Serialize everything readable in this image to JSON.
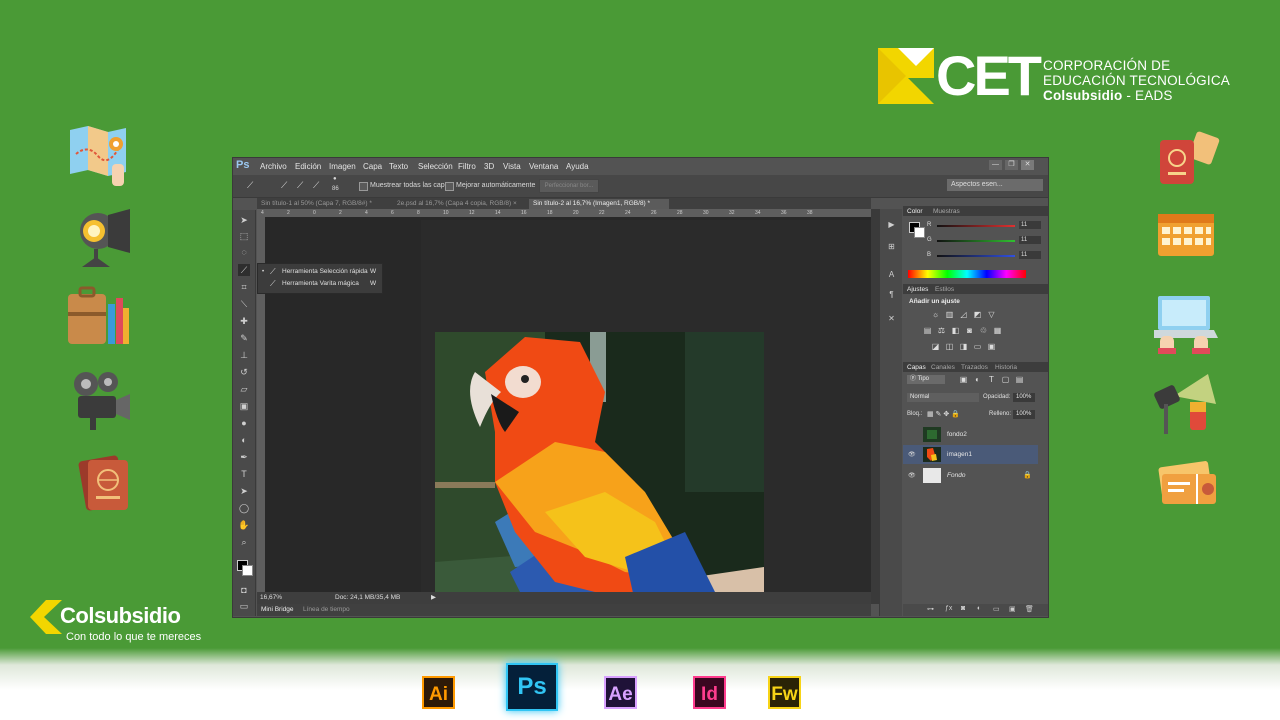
{
  "cet": {
    "word": "CET",
    "line1": "CORPORACIÓN DE",
    "line2": "EDUCACIÓN TECNOLÓGICA",
    "line3_bold": "Colsubsidio",
    "line3_rest": " - EADS"
  },
  "colsubsidio": {
    "name": "Colsubsidio",
    "tagline": "Con todo lo que te mereces"
  },
  "left_icons": [
    "map-pin-icon",
    "spotlight-icon",
    "luggage-books-icon",
    "film-camera-icon",
    "passport-icon"
  ],
  "right_icons": [
    "passport-ticket-icon",
    "calendar-icon",
    "laptop-hands-icon",
    "studio-light-icon",
    "tickets-icon"
  ],
  "photoshop": {
    "logo": "Ps",
    "menu": [
      "Archivo",
      "Edición",
      "Imagen",
      "Capa",
      "Texto",
      "Selección",
      "Filtro",
      "3D",
      "Vista",
      "Ventana",
      "Ayuda"
    ],
    "options": {
      "brush_size": "86",
      "sample_all": "Muestrear todas las capas",
      "auto_enhance": "Mejorar automáticamente",
      "refine_edge": "Perfeccionar bor...",
      "workspace": "Aspectos esen..."
    },
    "doc_tabs": [
      {
        "label": "Sin título-1 al 50% (Capa 7, RGB/8#) *",
        "active": false
      },
      {
        "label": "2e.psd al 16,7% (Capa 4 copia, RGB/8) ×",
        "active": false
      },
      {
        "label": "Sin título-2 al 16,7% (Imagen1, RGB/8) *",
        "active": true
      }
    ],
    "ruler_marks": [
      "4",
      "2",
      "0",
      "2",
      "4",
      "6",
      "8",
      "10",
      "12",
      "14",
      "16",
      "18",
      "20",
      "22",
      "24",
      "26",
      "28",
      "30",
      "32",
      "34",
      "36",
      "38"
    ],
    "flyout": [
      {
        "label": "Herramienta Selección rápida",
        "key": "W"
      },
      {
        "label": "Herramienta Varita mágica",
        "key": "W"
      }
    ],
    "status": {
      "zoom": "16,67%",
      "doc": "Doc: 24,1 MB/35,4 MB"
    },
    "mini_tabs": [
      "Mini Bridge",
      "Línea de tiempo"
    ],
    "color_panel": {
      "tabs": [
        "Color",
        "Muestras"
      ],
      "channels": [
        {
          "label": "R",
          "value": "11",
          "color": "#e03030"
        },
        {
          "label": "G",
          "value": "11",
          "color": "#30c030"
        },
        {
          "label": "B",
          "value": "11",
          "color": "#3050e0"
        }
      ]
    },
    "adjustments": {
      "tabs": [
        "Ajustes",
        "Estilos"
      ],
      "heading": "Añadir un ajuste"
    },
    "layers_panel": {
      "tabs": [
        "Capas",
        "Canales",
        "Trazados",
        "Historia"
      ],
      "filter": "Tipo",
      "blend_mode": "Normal",
      "opacity_label": "Opacidad:",
      "opacity_value": "100%",
      "lock_label": "Bloq.:",
      "fill_label": "Relleno:",
      "fill_value": "100%",
      "layers": [
        {
          "name": "fondo2",
          "visible": false,
          "selected": false
        },
        {
          "name": "imagen1",
          "visible": true,
          "selected": true
        },
        {
          "name": "Fondo",
          "visible": true,
          "selected": false
        }
      ]
    }
  },
  "apps": [
    {
      "label": "Ai",
      "bg": "#2e1a08",
      "fg": "#ff9a00"
    },
    {
      "label": "Ps",
      "bg": "#04203a",
      "fg": "#31c5f4"
    },
    {
      "label": "Ae",
      "bg": "#1f1238",
      "fg": "#d8a1ff"
    },
    {
      "label": "Id",
      "bg": "#3a0720",
      "fg": "#ff3d8e"
    },
    {
      "label": "Fw",
      "bg": "#2a2306",
      "fg": "#f7d417"
    }
  ]
}
